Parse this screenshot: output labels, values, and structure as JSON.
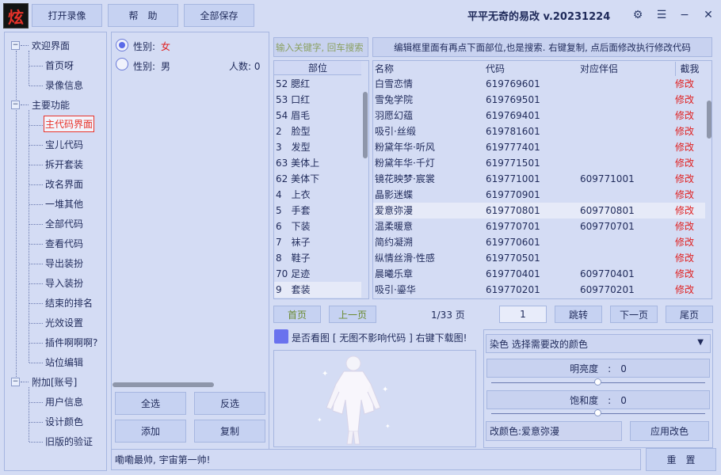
{
  "toolbar": {
    "logo_char": "炫",
    "open_record": "打开录像",
    "help": "帮　助",
    "save_all": "全部保存"
  },
  "window": {
    "title": "平平无奇的易改 v.20231224",
    "settings_icon": "⚙",
    "menu_icon": "☰",
    "minimize_icon": "−",
    "close_icon": "✕"
  },
  "tree": {
    "g1": {
      "label": "欢迎界面",
      "toggle": "−",
      "items": [
        "首页呀",
        "录像信息"
      ]
    },
    "g2": {
      "label": "主要功能",
      "toggle": "−",
      "items": [
        "主代码界面",
        "宝儿代码",
        "拆开套装",
        "改名界面",
        "一堆其他",
        "全部代码",
        "查看代码",
        "导出装扮",
        "导入装扮",
        "结束的排名",
        "光效设置",
        "插件啊啊啊?",
        "站位编辑"
      ]
    },
    "g3": {
      "label": "附加[账号]",
      "toggle": "−",
      "items": [
        "用户信息",
        "设计颜色",
        "旧版的验证"
      ]
    }
  },
  "gender": {
    "female_label": "性别:",
    "female_value": "女",
    "male_label": "性别:",
    "male_value": "男",
    "count_label": "人数: 0"
  },
  "middle_buttons": {
    "select_all": "全选",
    "invert": "反选",
    "add": "添加",
    "copy": "复制"
  },
  "search": {
    "placeholder": "输入关键字, 回车搜索",
    "hint": "编辑框里面有再点下面部位,也是搜索. 右键复制, 点后面修改执行修改代码"
  },
  "parts": {
    "header": "部位",
    "items": [
      "52 腮红",
      "53 口红",
      "54 眉毛",
      "2　脸型",
      "3　发型",
      "63 美体上",
      "62 美体下",
      "4　上衣",
      "5　手套",
      "6　下装",
      "7　袜子",
      "8　鞋子",
      "70 足迹",
      "9　套装"
    ]
  },
  "table": {
    "headers": [
      "名称",
      "代码",
      "对应伴侣",
      "截我"
    ],
    "rows": [
      {
        "name": "白雪恋情",
        "code": "619769601",
        "partner": "",
        "action": "修改"
      },
      {
        "name": "雪兔学院",
        "code": "619769501",
        "partner": "",
        "action": "修改"
      },
      {
        "name": "羽愿幻蕴",
        "code": "619769401",
        "partner": "",
        "action": "修改"
      },
      {
        "name": "吸引·丝缎",
        "code": "619781601",
        "partner": "",
        "action": "修改"
      },
      {
        "name": "粉黛年华·听风",
        "code": "619777401",
        "partner": "",
        "action": "修改"
      },
      {
        "name": "粉黛年华·千灯",
        "code": "619771501",
        "partner": "",
        "action": "修改"
      },
      {
        "name": "镜花映梦·宸裳",
        "code": "619771001",
        "partner": "609771001",
        "action": "修改"
      },
      {
        "name": "晶影迷蝶",
        "code": "619770901",
        "partner": "",
        "action": "修改"
      },
      {
        "name": "爱意弥漫",
        "code": "619770801",
        "partner": "609770801",
        "action": "修改"
      },
      {
        "name": "温柔暖意",
        "code": "619770701",
        "partner": "609770701",
        "action": "修改"
      },
      {
        "name": "简约凝溯",
        "code": "619770601",
        "partner": "",
        "action": "修改"
      },
      {
        "name": "纵情丝滑·性感",
        "code": "619770501",
        "partner": "",
        "action": "修改"
      },
      {
        "name": "晨曦乐章",
        "code": "619770401",
        "partner": "609770401",
        "action": "修改"
      },
      {
        "name": "吸引·鎏华",
        "code": "619770201",
        "partner": "609770201",
        "action": "修改"
      }
    ]
  },
  "pagination": {
    "first": "首页",
    "prev": "上一页",
    "page_info": "1/33 页",
    "page_input": "1",
    "jump": "跳转",
    "next": "下一页",
    "last": "尾页"
  },
  "preview": {
    "checkbox_label": "是否看图 [ 无图不影响代码 ] 右键下载图!"
  },
  "color": {
    "dropdown": "染色 选择需要改的颜色",
    "brightness_label": "明亮度　:　0",
    "saturation_label": "饱和度　:　0",
    "brightness_value": 0,
    "saturation_value": 0,
    "target_label": "改颜色:爱意弥漫",
    "apply": "应用改色"
  },
  "status": {
    "message": "嘞嘞最帅, 宇宙第一帅!",
    "reset": "重　置"
  },
  "colors": {
    "accent_red": "#e02020",
    "bg": "#d4dcf4",
    "button": "#c6d2f2"
  }
}
